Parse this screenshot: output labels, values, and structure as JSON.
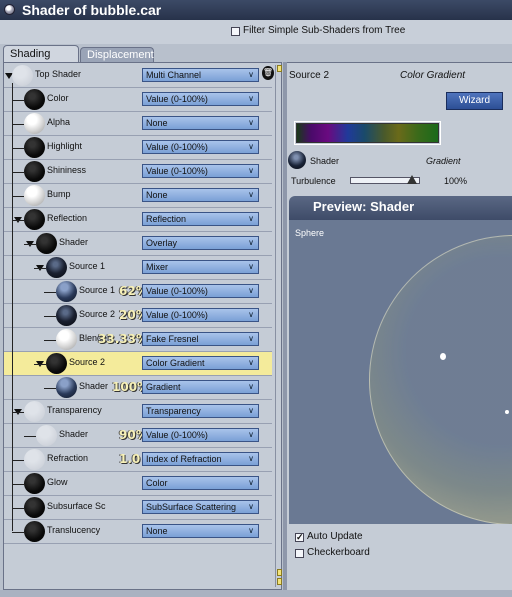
{
  "window": {
    "title": "Shader of bubble.car"
  },
  "filter": {
    "label": "Filter Simple Sub-Shaders from Tree",
    "checked": false
  },
  "tabs": [
    {
      "label": "Shading",
      "active": true
    },
    {
      "label": "Displacement",
      "active": false
    }
  ],
  "tree": {
    "rows": [
      {
        "label": "Top Shader",
        "value": "Multi Channel",
        "ball": "grey",
        "indent": 0,
        "expanded": true,
        "pct": ""
      },
      {
        "label": "Color",
        "value": "Value (0-100%)",
        "ball": "black",
        "indent": 1,
        "pct": ""
      },
      {
        "label": "Alpha",
        "value": "None",
        "ball": "white",
        "indent": 1,
        "pct": ""
      },
      {
        "label": "Highlight",
        "value": "Value (0-100%)",
        "ball": "black",
        "indent": 1,
        "pct": ""
      },
      {
        "label": "Shininess",
        "value": "Value (0-100%)",
        "ball": "black",
        "indent": 1,
        "pct": ""
      },
      {
        "label": "Bump",
        "value": "None",
        "ball": "white",
        "indent": 1,
        "pct": ""
      },
      {
        "label": "Reflection",
        "value": "Reflection",
        "ball": "black",
        "indent": 1,
        "expanded": true,
        "pct": ""
      },
      {
        "label": "Shader",
        "value": "Overlay",
        "ball": "black",
        "indent": 2,
        "expanded": true,
        "pct": ""
      },
      {
        "label": "Source 1",
        "value": "Mixer",
        "ball": "dark",
        "indent": 3,
        "expanded": true,
        "pct": ""
      },
      {
        "label": "Source 1",
        "value": "Value (0-100%)",
        "ball": "glassy",
        "indent": 4,
        "pct": "62%"
      },
      {
        "label": "Source 2",
        "value": "Value (0-100%)",
        "ball": "dark",
        "indent": 4,
        "pct": "20%"
      },
      {
        "label": "Blender",
        "value": "Fake Fresnel",
        "ball": "white",
        "indent": 4,
        "pct": "33.33%"
      },
      {
        "label": "Source 2",
        "value": "Color Gradient",
        "ball": "black",
        "indent": 3,
        "expanded": true,
        "selected": true,
        "pct": ""
      },
      {
        "label": "Shader",
        "value": "Gradient",
        "ball": "glassy",
        "indent": 4,
        "pct": "100%"
      },
      {
        "label": "Transparency",
        "value": "Transparency",
        "ball": "grey",
        "indent": 1,
        "expanded": true,
        "pct": ""
      },
      {
        "label": "Shader",
        "value": "Value (0-100%)",
        "ball": "grey",
        "indent": 2,
        "pct": "90%"
      },
      {
        "label": "Refraction",
        "value": "Index of Refraction",
        "ball": "grey",
        "indent": 1,
        "pct": "1.0"
      },
      {
        "label": "Glow",
        "value": "Color",
        "ball": "black",
        "indent": 1,
        "pct": ""
      },
      {
        "label": "Subsurface Sc",
        "value": "SubSurface Scattering",
        "ball": "black",
        "indent": 1,
        "pct": ""
      },
      {
        "label": "Translucency",
        "value": "None",
        "ball": "black",
        "indent": 1,
        "pct": ""
      }
    ]
  },
  "right": {
    "header_left": "Source 2",
    "header_right": "Color Gradient",
    "wizard_label": "Wizard",
    "shader_label": "Shader",
    "shader_value": "Gradient",
    "turbulence_label": "Turbulence",
    "turbulence_value": "100%",
    "preview_title": "Preview: Shader",
    "preview_shape": "Sphere",
    "auto_update_label": "Auto Update",
    "auto_update_checked": true,
    "checkerboard_label": "Checkerboard",
    "checkerboard_checked": false
  },
  "colors": {
    "selected_row": "#f4eb9b",
    "dropdown": "#8fb0e0",
    "wizard": "#3d62aa",
    "title_bar": "#2f3b56"
  }
}
